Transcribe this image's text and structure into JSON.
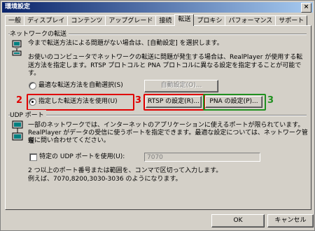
{
  "window": {
    "title": "環境設定",
    "close_label": "×"
  },
  "tabs": [
    "一般",
    "ディスプレイ",
    "コンテンツ",
    "アップグレード",
    "接続",
    "転送",
    "プロキシ",
    "パフォーマンス",
    "サポート"
  ],
  "active_tab": "転送",
  "transport": {
    "group_label": "ネットワークの転送",
    "desc1": "今まで転送方法による問題がない場合は、[自動設定] を選択します。",
    "desc2_line1": "お使いのコンピュータでネットワークの転送に問題が発生する場合は、RealPlayer が使用する転",
    "desc2_line2": "送方法を指定します。RTSP プロトコルと PNA プロトコルに異なる設定を指定することが可能で",
    "desc2_line3": "す。",
    "radio_auto_label": "最適な転送方法を自動選択(S)",
    "auto_settings_button": "自動設定(O)...",
    "radio_manual_label": "指定した転送方法を使用(U)",
    "rtsp_button": "RTSP の設定(R)...",
    "pna_button": "PNA の設定(P)..."
  },
  "udp": {
    "group_label": "UDP ポート",
    "desc_line1": "一部のネットワークでは、インターネットのアプリケーションに使えるポートが限られています。",
    "desc_line2": "RealPlayer がデータの受信に使うポートを指定できます。最適な設定については、ネットワーク管理",
    "desc_line3": "者に問い合わせてください。",
    "checkbox_label": "特定の UDP ポートを使用(U):",
    "port_value": "7070",
    "hint_line1": "2 つ以上のポート番号または範囲を、コンマで区切って入力します。",
    "hint_line2": "例えば、7070,8200,3030-3036 のようになります。"
  },
  "annotations": {
    "n2": "2",
    "n3_red": "3",
    "n3_green": "3"
  },
  "footer": {
    "ok": "OK",
    "cancel": "キャンセル"
  },
  "colors": {
    "title_start": "#0a246a",
    "annotation_red": "#e00000",
    "annotation_green": "#209020"
  }
}
